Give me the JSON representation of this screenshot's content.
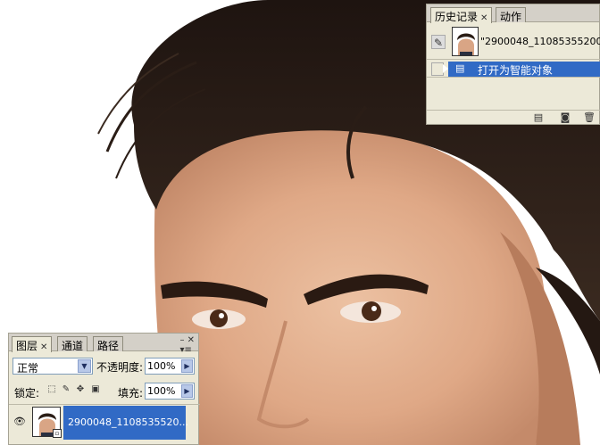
{
  "history_panel": {
    "tabs": [
      {
        "label": "历史记录",
        "active": true,
        "closable": true
      },
      {
        "label": "动作",
        "active": false,
        "closable": false
      }
    ],
    "snapshot_name": "\"2900048_11085355200...",
    "states": [
      {
        "label": "打开为智能对象",
        "selected": true
      }
    ],
    "footer_icons": [
      "new-document-icon",
      "camera-icon",
      "trash-icon"
    ]
  },
  "layers_panel": {
    "tabs": [
      {
        "label": "图层",
        "active": true,
        "closable": true
      },
      {
        "label": "通道",
        "active": false,
        "closable": false
      },
      {
        "label": "路径",
        "active": false,
        "closable": false
      }
    ],
    "blend_mode": "正常",
    "opacity_label": "不透明度:",
    "opacity_value": "100%",
    "lock_label": "锁定:",
    "fill_label": "填充:",
    "fill_value": "100%",
    "layers": [
      {
        "name": "2900048_1108535520...",
        "visible": true,
        "selected": true,
        "smart_object": true
      }
    ]
  },
  "colors": {
    "panel_bg": "#ece9d8",
    "selection": "#316ac5",
    "hair": "#2a1d16",
    "skin": "#e6b393"
  }
}
